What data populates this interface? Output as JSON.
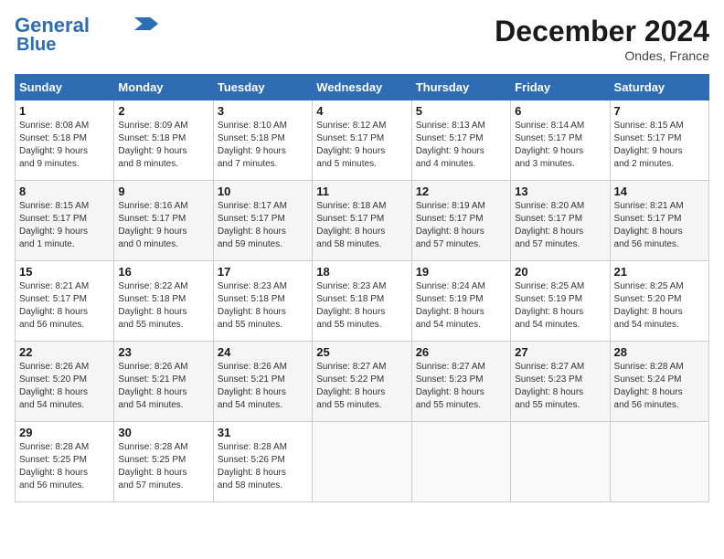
{
  "header": {
    "logo_line1": "General",
    "logo_line2": "Blue",
    "month": "December 2024",
    "location": "Ondes, France"
  },
  "days_of_week": [
    "Sunday",
    "Monday",
    "Tuesday",
    "Wednesday",
    "Thursday",
    "Friday",
    "Saturday"
  ],
  "weeks": [
    [
      {
        "day": "1",
        "info": "Sunrise: 8:08 AM\nSunset: 5:18 PM\nDaylight: 9 hours\nand 9 minutes."
      },
      {
        "day": "2",
        "info": "Sunrise: 8:09 AM\nSunset: 5:18 PM\nDaylight: 9 hours\nand 8 minutes."
      },
      {
        "day": "3",
        "info": "Sunrise: 8:10 AM\nSunset: 5:18 PM\nDaylight: 9 hours\nand 7 minutes."
      },
      {
        "day": "4",
        "info": "Sunrise: 8:12 AM\nSunset: 5:17 PM\nDaylight: 9 hours\nand 5 minutes."
      },
      {
        "day": "5",
        "info": "Sunrise: 8:13 AM\nSunset: 5:17 PM\nDaylight: 9 hours\nand 4 minutes."
      },
      {
        "day": "6",
        "info": "Sunrise: 8:14 AM\nSunset: 5:17 PM\nDaylight: 9 hours\nand 3 minutes."
      },
      {
        "day": "7",
        "info": "Sunrise: 8:15 AM\nSunset: 5:17 PM\nDaylight: 9 hours\nand 2 minutes."
      }
    ],
    [
      {
        "day": "8",
        "info": "Sunrise: 8:15 AM\nSunset: 5:17 PM\nDaylight: 9 hours\nand 1 minute."
      },
      {
        "day": "9",
        "info": "Sunrise: 8:16 AM\nSunset: 5:17 PM\nDaylight: 9 hours\nand 0 minutes."
      },
      {
        "day": "10",
        "info": "Sunrise: 8:17 AM\nSunset: 5:17 PM\nDaylight: 8 hours\nand 59 minutes."
      },
      {
        "day": "11",
        "info": "Sunrise: 8:18 AM\nSunset: 5:17 PM\nDaylight: 8 hours\nand 58 minutes."
      },
      {
        "day": "12",
        "info": "Sunrise: 8:19 AM\nSunset: 5:17 PM\nDaylight: 8 hours\nand 57 minutes."
      },
      {
        "day": "13",
        "info": "Sunrise: 8:20 AM\nSunset: 5:17 PM\nDaylight: 8 hours\nand 57 minutes."
      },
      {
        "day": "14",
        "info": "Sunrise: 8:21 AM\nSunset: 5:17 PM\nDaylight: 8 hours\nand 56 minutes."
      }
    ],
    [
      {
        "day": "15",
        "info": "Sunrise: 8:21 AM\nSunset: 5:17 PM\nDaylight: 8 hours\nand 56 minutes."
      },
      {
        "day": "16",
        "info": "Sunrise: 8:22 AM\nSunset: 5:18 PM\nDaylight: 8 hours\nand 55 minutes."
      },
      {
        "day": "17",
        "info": "Sunrise: 8:23 AM\nSunset: 5:18 PM\nDaylight: 8 hours\nand 55 minutes."
      },
      {
        "day": "18",
        "info": "Sunrise: 8:23 AM\nSunset: 5:18 PM\nDaylight: 8 hours\nand 55 minutes."
      },
      {
        "day": "19",
        "info": "Sunrise: 8:24 AM\nSunset: 5:19 PM\nDaylight: 8 hours\nand 54 minutes."
      },
      {
        "day": "20",
        "info": "Sunrise: 8:25 AM\nSunset: 5:19 PM\nDaylight: 8 hours\nand 54 minutes."
      },
      {
        "day": "21",
        "info": "Sunrise: 8:25 AM\nSunset: 5:20 PM\nDaylight: 8 hours\nand 54 minutes."
      }
    ],
    [
      {
        "day": "22",
        "info": "Sunrise: 8:26 AM\nSunset: 5:20 PM\nDaylight: 8 hours\nand 54 minutes."
      },
      {
        "day": "23",
        "info": "Sunrise: 8:26 AM\nSunset: 5:21 PM\nDaylight: 8 hours\nand 54 minutes."
      },
      {
        "day": "24",
        "info": "Sunrise: 8:26 AM\nSunset: 5:21 PM\nDaylight: 8 hours\nand 54 minutes."
      },
      {
        "day": "25",
        "info": "Sunrise: 8:27 AM\nSunset: 5:22 PM\nDaylight: 8 hours\nand 55 minutes."
      },
      {
        "day": "26",
        "info": "Sunrise: 8:27 AM\nSunset: 5:23 PM\nDaylight: 8 hours\nand 55 minutes."
      },
      {
        "day": "27",
        "info": "Sunrise: 8:27 AM\nSunset: 5:23 PM\nDaylight: 8 hours\nand 55 minutes."
      },
      {
        "day": "28",
        "info": "Sunrise: 8:28 AM\nSunset: 5:24 PM\nDaylight: 8 hours\nand 56 minutes."
      }
    ],
    [
      {
        "day": "29",
        "info": "Sunrise: 8:28 AM\nSunset: 5:25 PM\nDaylight: 8 hours\nand 56 minutes."
      },
      {
        "day": "30",
        "info": "Sunrise: 8:28 AM\nSunset: 5:25 PM\nDaylight: 8 hours\nand 57 minutes."
      },
      {
        "day": "31",
        "info": "Sunrise: 8:28 AM\nSunset: 5:26 PM\nDaylight: 8 hours\nand 58 minutes."
      },
      {
        "day": "",
        "info": ""
      },
      {
        "day": "",
        "info": ""
      },
      {
        "day": "",
        "info": ""
      },
      {
        "day": "",
        "info": ""
      }
    ]
  ]
}
